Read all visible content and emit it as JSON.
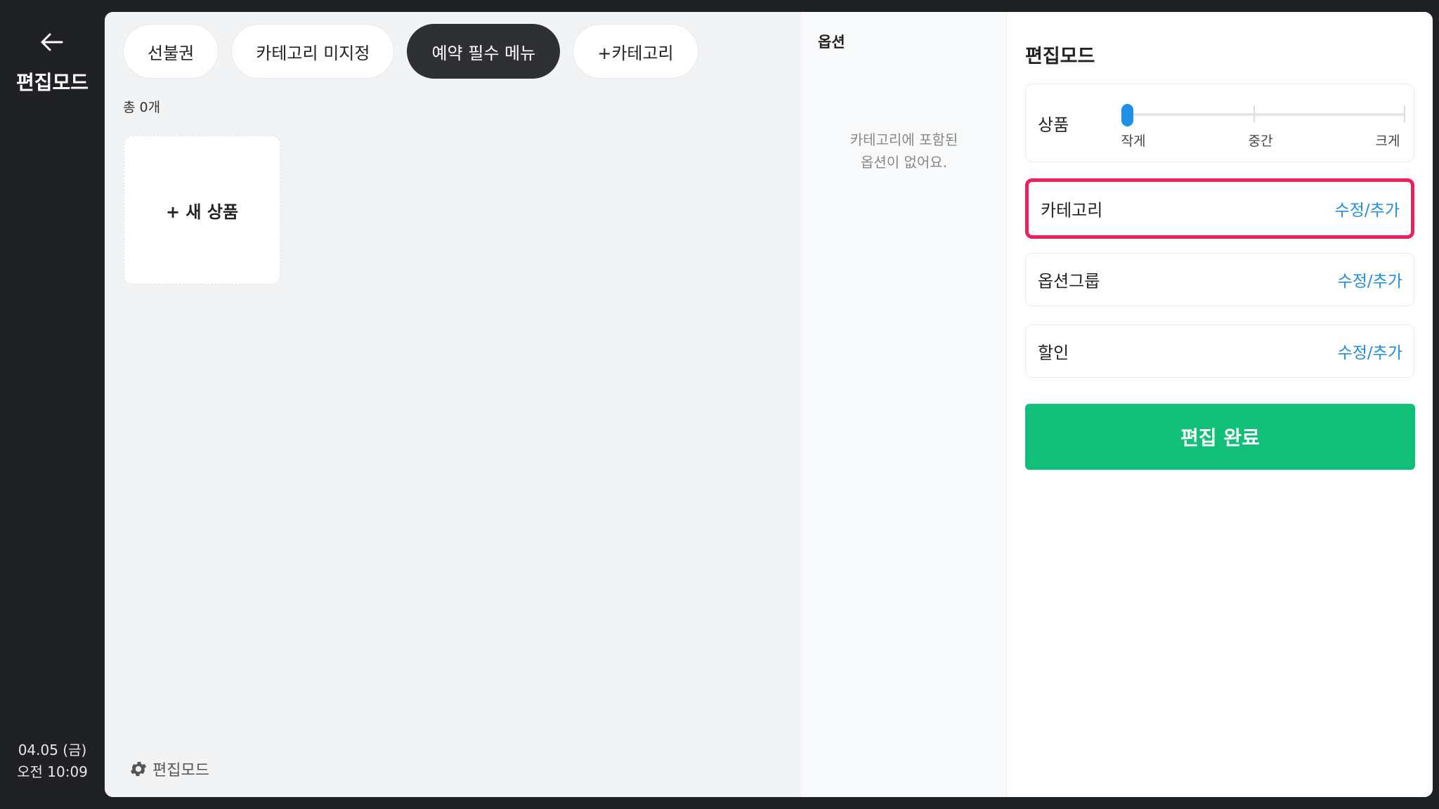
{
  "rail": {
    "title": "편집모드",
    "date": "04.05 (금)",
    "time": "오전 10:09"
  },
  "tabs": [
    {
      "label": "선불권",
      "active": false
    },
    {
      "label": "카테고리 미지정",
      "active": false
    },
    {
      "label": "예약 필수 메뉴",
      "active": true
    },
    {
      "label": "+카테고리",
      "active": false
    }
  ],
  "products": {
    "count_label": "총 0개",
    "new_product_label": "+ 새 상품",
    "footer_mode_label": "편집모드"
  },
  "options": {
    "title": "옵션",
    "empty_line1": "카테고리에 포함된",
    "empty_line2": "옵션이 없어요."
  },
  "edit": {
    "title": "편집모드",
    "size": {
      "label": "상품",
      "options": [
        "작게",
        "중간",
        "크게"
      ],
      "selected_index": 0
    },
    "rows": [
      {
        "label": "카테고리",
        "action": "수정/추가",
        "highlighted": true
      },
      {
        "label": "옵션그룹",
        "action": "수정/추가",
        "highlighted": false
      },
      {
        "label": "할인",
        "action": "수정/추가",
        "highlighted": false
      }
    ],
    "done_label": "편집 완료"
  },
  "colors": {
    "accent_blue": "#1f8fe0",
    "done_green": "#12bf79",
    "highlight_pink": "#ef1f5a",
    "dark": "#202124"
  }
}
